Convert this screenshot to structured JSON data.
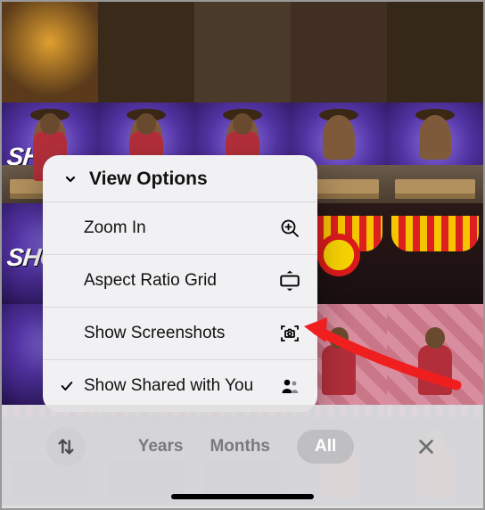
{
  "popover": {
    "title": "View Options",
    "items": [
      {
        "label": "Zoom In",
        "icon": "zoom-in-icon",
        "checked": false
      },
      {
        "label": "Aspect Ratio Grid",
        "icon": "aspect-ratio-icon",
        "checked": false
      },
      {
        "label": "Show Screenshots",
        "icon": "screenshot-icon",
        "checked": false
      },
      {
        "label": "Show Shared with You",
        "icon": "shared-with-you-icon",
        "checked": true
      }
    ]
  },
  "bottombar": {
    "sort_icon": "sort-icon",
    "segments": {
      "years": "Years",
      "months": "Months",
      "all": "All"
    },
    "close_icon": "close-icon"
  },
  "annotation": {
    "arrow_target": "show-screenshots"
  }
}
